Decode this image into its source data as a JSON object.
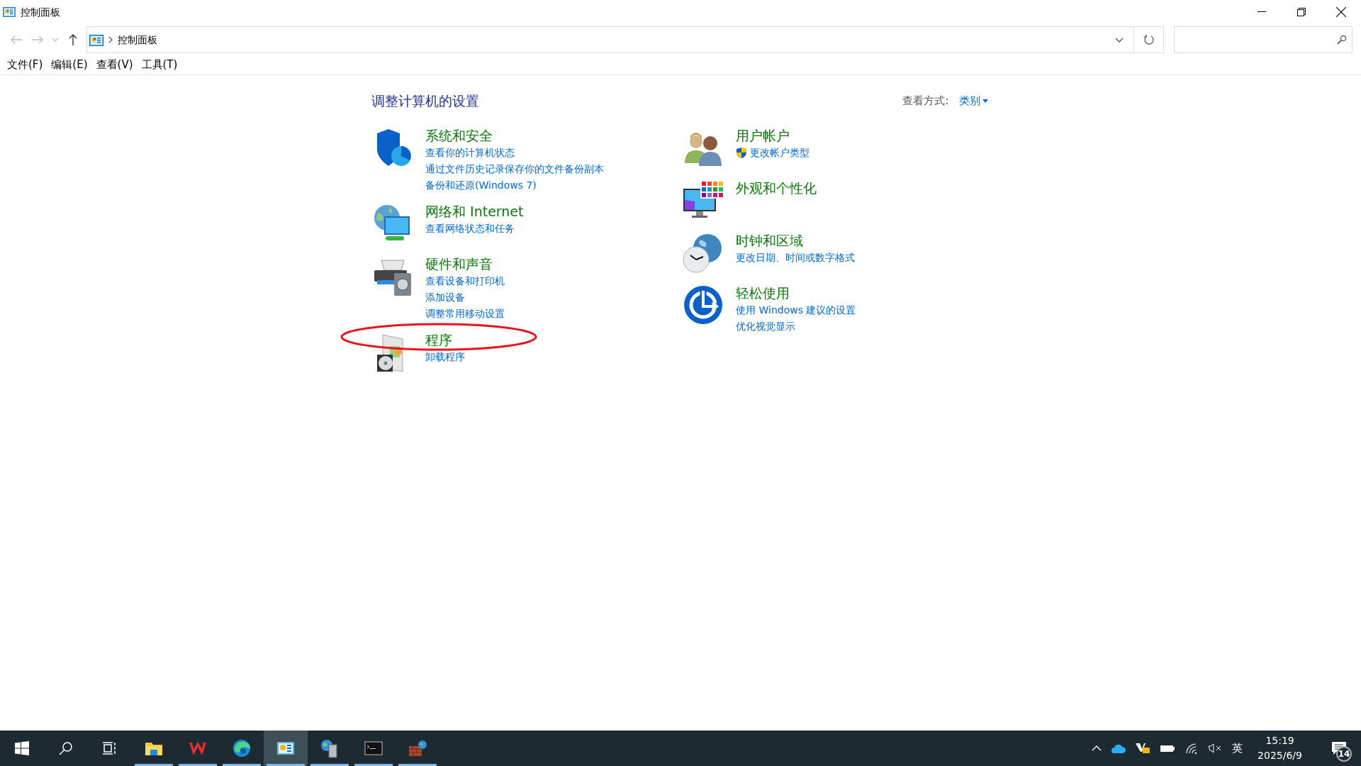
{
  "window": {
    "title": "控制面板"
  },
  "address_bar": {
    "path": "控制面板"
  },
  "menu": [
    "文件(F)",
    "编辑(E)",
    "查看(V)",
    "工具(T)"
  ],
  "heading": "调整计算机的设置",
  "view_by": {
    "label": "查看方式:",
    "value": "类别"
  },
  "columns": [
    [
      {
        "kind": "security",
        "title": "系统和安全",
        "circled": false,
        "links": [
          {
            "text": "查看你的计算机状态",
            "uac": false
          },
          {
            "text": "通过文件历史记录保存你的文件备份副本",
            "uac": false
          },
          {
            "text": "备份和还原(Windows 7)",
            "uac": false
          }
        ]
      },
      {
        "kind": "network",
        "title": "网络和 Internet",
        "circled": false,
        "links": [
          {
            "text": "查看网络状态和任务",
            "uac": false
          }
        ]
      },
      {
        "kind": "hardware",
        "title": "硬件和声音",
        "circled": false,
        "links": [
          {
            "text": "查看设备和打印机",
            "uac": false
          },
          {
            "text": "添加设备",
            "uac": false
          },
          {
            "text": "调整常用移动设置",
            "uac": false
          }
        ]
      },
      {
        "kind": "programs",
        "title": "程序",
        "circled": true,
        "links": [
          {
            "text": "卸载程序",
            "uac": false
          }
        ]
      }
    ],
    [
      {
        "kind": "users",
        "title": "用户帐户",
        "circled": false,
        "links": [
          {
            "text": "更改帐户类型",
            "uac": true
          }
        ]
      },
      {
        "kind": "appearance",
        "title": "外观和个性化",
        "circled": false
      },
      {
        "kind": "clock",
        "title": "时钟和区域",
        "circled": false,
        "links": [
          {
            "text": "更改日期、时间或数字格式",
            "uac": false
          }
        ]
      },
      {
        "kind": "ease",
        "title": "轻松使用",
        "circled": false,
        "links": [
          {
            "text": "使用 Windows 建议的设置",
            "uac": false
          },
          {
            "text": "优化视觉显示",
            "uac": false
          }
        ]
      }
    ]
  ],
  "taskbar": {
    "apps": [
      {
        "kind": "explorer",
        "selected": false
      },
      {
        "kind": "wps",
        "selected": false
      },
      {
        "kind": "edge",
        "selected": false
      },
      {
        "kind": "control",
        "selected": true
      },
      {
        "kind": "server",
        "selected": false
      },
      {
        "kind": "terminal",
        "selected": false
      },
      {
        "kind": "firewall",
        "selected": false
      }
    ],
    "ime": "英",
    "time": "15:19",
    "date": "2025/6/9",
    "notifications": "14"
  }
}
